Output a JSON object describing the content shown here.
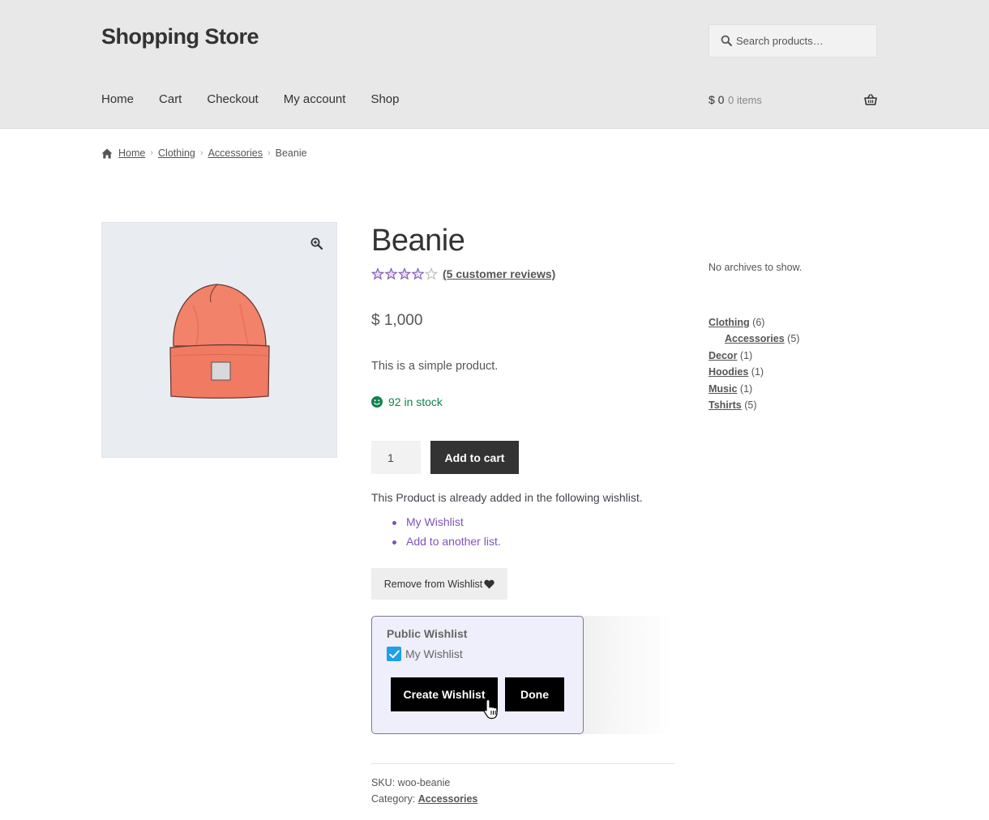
{
  "header": {
    "site_title": "Shopping Store",
    "search_placeholder": "Search products…",
    "nav": [
      "Home",
      "Cart",
      "Checkout",
      "My account",
      "Shop"
    ],
    "cart_total": "$ 0",
    "cart_count": "0 items"
  },
  "breadcrumb": {
    "items": [
      "Home",
      "Clothing",
      "Accessories"
    ],
    "current": "Beanie"
  },
  "product": {
    "title": "Beanie",
    "rating": 3.6,
    "rating_max": 5,
    "reviews_label": "(5 customer reviews)",
    "price": "$ 1,000",
    "short_description": "This is a simple product.",
    "stock": "92 in stock",
    "quantity": "1",
    "add_to_cart_label": "Add to cart",
    "sku_label": "SKU:",
    "sku": "woo-beanie",
    "category_label": "Category:",
    "category": "Accessories"
  },
  "wishlist": {
    "note": "This Product is already added in the following wishlist.",
    "links": [
      "My Wishlist",
      "Add to another list."
    ],
    "remove_label": "Remove from Wishlist",
    "popup": {
      "title": "Public Wishlist",
      "checkbox_label": "My Wishlist",
      "checked": true,
      "create_label": "Create Wishlist",
      "done_label": "Done"
    }
  },
  "sidebar": {
    "no_archives": "No archives to show.",
    "categories": [
      {
        "name": "Clothing",
        "count": "(6)",
        "child": false
      },
      {
        "name": "Accessories",
        "count": "(5)",
        "child": true
      },
      {
        "name": "Decor",
        "count": "(1)",
        "child": false
      },
      {
        "name": "Hoodies",
        "count": "(1)",
        "child": false
      },
      {
        "name": "Music",
        "count": "(1)",
        "child": false
      },
      {
        "name": "Tshirts",
        "count": "(5)",
        "child": false
      }
    ]
  },
  "colors": {
    "header_bg": "#e8e8e8",
    "button_dark": "#333333",
    "wishlist_link": "#7f54b3",
    "stock_green": "#0f834d",
    "checkbox_blue": "#1ea0e8",
    "popup_bg": "#efeffb"
  },
  "icons": [
    "search-icon",
    "basket-icon",
    "home-icon",
    "zoom-icon",
    "star-icon",
    "smile-icon",
    "heart-icon",
    "check-icon",
    "cursor-icon"
  ]
}
